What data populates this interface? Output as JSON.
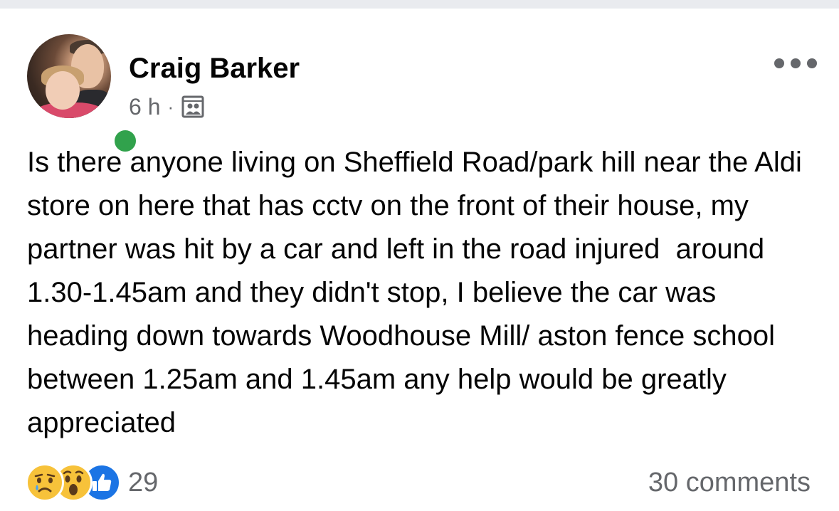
{
  "post": {
    "author": "Craig Barker",
    "time": "6 h",
    "separator": "·",
    "audience_icon": "group-audience-icon",
    "text": "Is there anyone living on Sheffield Road/park hill near the Aldi store on here that has cctv on the front of their house, my partner was hit by a car and left in the road injured  around 1.30-1.45am and they didn't stop, I believe the car was heading down towards Woodhouse Mill/ aston fence school between 1.25am and 1.45am any help would be greatly appreciated"
  },
  "footer": {
    "reaction_icons": [
      "sad-reaction-icon",
      "wow-reaction-icon",
      "like-reaction-icon"
    ],
    "reaction_count": "29",
    "comments": "30 comments"
  },
  "colors": {
    "online": "#31a24c",
    "secondary_text": "#65676b",
    "like_blue": "#1b74e4",
    "emoji_yellow": "#f7c23a"
  }
}
